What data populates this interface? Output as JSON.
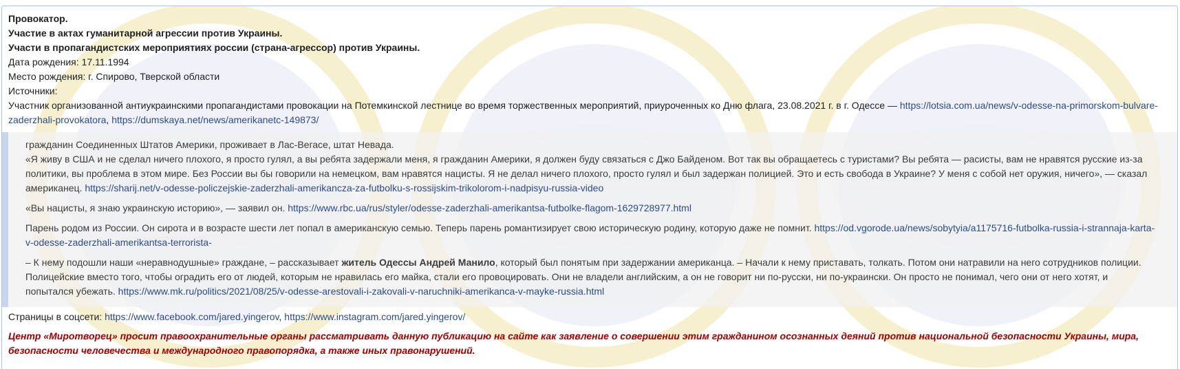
{
  "header": {
    "role": "Провокатор.",
    "activity1": "Участие в актах гуманитарной агрессии против Украины.",
    "activity2": "Участи в пропагандистских мероприятиях россии (страна-агрессор) против Украины."
  },
  "bio": {
    "birth_date": "Дата рождения: 17.11.1994",
    "birth_place": "Место рождения: г. Спирово, Тверской области",
    "sources_label": "Источники:",
    "sources_text": "Участник организованной антиукраинскими пропагандистами  провокации на Потемкинской лестнице во время торжественных мероприятий, приуроченных ко Дню флага, 23.08.2021 г. в г. Одессе — ",
    "source_link1": "https://lotsia.com.ua/news/v-odesse-na-primorskom-bulvare-zaderzhali-provokatora",
    "source_sep": ", ",
    "source_link2": "https://dumskaya.net/news/amerikanetc-149873/"
  },
  "quote": {
    "p1_line1": "гражданин Соединенных Штатов Америки, проживает в Лас-Вегасе, штат Невада.",
    "p1_text": "«Я живу в США и не сделал ничего плохого, я просто гулял, а вы ребята задержали меня, я гражданин Америки, я должен буду связаться с Джо Байденом. Вот так вы обращаетесь с туристами? Вы ребята — расисты, вам не нравятся русские из-за политики, вы проблема в этом мире. Без России вы бы говорили на немецком, вам нравятся нацисты. Я не делал ничего плохого, просто гулял и был задержан полицией. Это и есть свобода в Украине? У меня с собой нет оружия, ничего», — сказал американец. ",
    "p1_link": "https://sharij.net/v-odesse-policzejskie-zaderzhali-amerikancza-za-futbolku-s-rossijskim-trikolorom-i-nadpisyu-russia-video",
    "p2_text": "«Вы нацисты, я знаю украинскую историю», — заявил он. ",
    "p2_link": "https://www.rbc.ua/rus/styler/odesse-zaderzhali-amerikantsa-futbolke-flagom-1629728977.html",
    "p3_text": "Парень родом из России. Он сирота и в возрасте шести лет попал в американскую семью. Теперь парень романтизирует свою историческую родину, которую даже не помнит. ",
    "p3_link": "https://od.vgorode.ua/news/sobytyia/a1175716-futbolka-russia-i-strannaja-karta-v-odesse-zaderzhali-amerikantsa-terrorista-",
    "p4_pre": "– К нему подошли наши «неравнодушные» граждане, – рассказывает ",
    "p4_bold": "житель Одессы Андрей Манило",
    "p4_text": ", который был понятым при задержании американца. – Начали к нему приставать, толкать. Потом они натравили на него сотрудников полиции. Полицейские вместо того, чтобы оградить его от людей, которым не нравилась его майка, стали его провоцировать. Они не владели английским, а он не говорит ни по-русски, ни по-украински. Он просто не понимал, чего они от него хотят, и попытался убежать.  ",
    "p4_link": "https://www.mk.ru/politics/2021/08/25/v-odesse-arestovali-i-zakovali-v-naruchniki-amerikanca-v-mayke-russia.html"
  },
  "social": {
    "label": "Страницы в соцсети: ",
    "link1": "https://www.facebook.com/jared.yingerov",
    "sep": ", ",
    "link2": "https://www.instagram.com/jared.yingerov/"
  },
  "warning": "Центр «Миротворец» просит правоохранительные органы рассматривать данную публикацию на сайте как заявление о совершении этим гражданином осознанных деяний против национальной безопасности Украины, мира, безопасности человечества и международного правопорядка, а также иных правонарушений.",
  "colors": {
    "link": "#2a4b8d",
    "warning": "#a30000",
    "quote_border": "#c6d5f0"
  }
}
